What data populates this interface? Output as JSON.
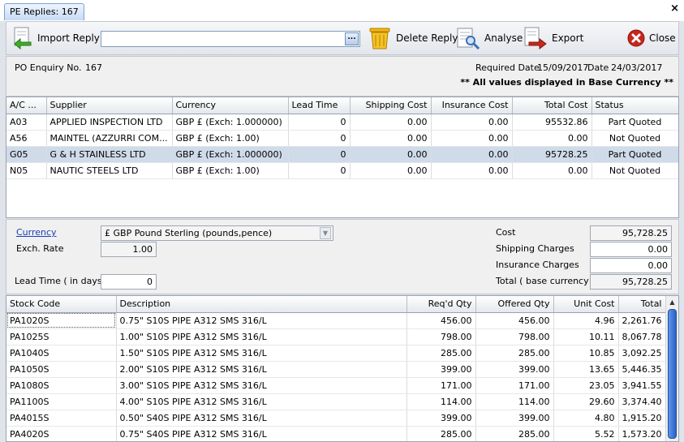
{
  "window": {
    "tab_title": "PE Replies: 167",
    "close_glyph": "×"
  },
  "toolbar": {
    "import_label": "Import Reply",
    "import_value": "",
    "browse_label": "...",
    "delete_label": "Delete Reply",
    "analyse_label": "Analyse",
    "export_label": "Export",
    "close_label": "Close"
  },
  "header": {
    "po_label": "PO Enquiry No.",
    "po_value": "167",
    "required_date_label": "Required Date",
    "required_date_value": "15/09/2017",
    "date_label": "Date",
    "date_value": "24/03/2017",
    "base_currency_note": "** All values displayed in Base Currency **"
  },
  "suppliers": {
    "columns": [
      "A/C ...",
      "Supplier",
      "Currency",
      "Lead Time",
      "Shipping Cost",
      "Insurance Cost",
      "Total Cost",
      "Status"
    ],
    "rows": [
      [
        "A03",
        "APPLIED INSPECTION LTD",
        "GBP £ (Exch: 1.000000)",
        "0",
        "0.00",
        "0.00",
        "95532.86",
        "Part Quoted"
      ],
      [
        "A56",
        "MAINTEL (AZZURRI COM...",
        "GBP £ (Exch: 1.00)",
        "0",
        "0.00",
        "0.00",
        "0.00",
        "Not Quoted"
      ],
      [
        "G05",
        "G & H STAINLESS LTD",
        "GBP £ (Exch: 1.000000)",
        "0",
        "0.00",
        "0.00",
        "95728.25",
        "Part Quoted"
      ],
      [
        "N05",
        "NAUTIC STEELS LTD",
        "GBP £ (Exch: 1.00)",
        "0",
        "0.00",
        "0.00",
        "0.00",
        "Not Quoted"
      ]
    ],
    "selected_row": 2
  },
  "detail": {
    "currency_label": "Currency",
    "currency_value": "£ GBP Pound Sterling (pounds,pence)",
    "exch_rate_label": "Exch. Rate",
    "exch_rate_value": "1.00",
    "lead_time_label": "Lead Time ( in days )",
    "lead_time_value": "0",
    "cost_label": "Cost",
    "cost_value": "95,728.25",
    "shipping_label": "Shipping Charges",
    "shipping_value": "0.00",
    "insurance_label": "Insurance Charges",
    "insurance_value": "0.00",
    "total_label": "Total ( base currency )",
    "total_value": "95,728.25"
  },
  "items": {
    "columns": [
      "Stock Code",
      "Description",
      "Req'd Qty",
      "Offered Qty",
      "Unit Cost",
      "Total"
    ],
    "rows": [
      [
        "PA1020S",
        "0.75\" S10S PIPE A312 SMS 316/L",
        "456.00",
        "456.00",
        "4.96",
        "2,261.76"
      ],
      [
        "PA1025S",
        "1.00\" S10S PIPE A312 SMS 316/L",
        "798.00",
        "798.00",
        "10.11",
        "8,067.78"
      ],
      [
        "PA1040S",
        "1.50\" S10S PIPE A312 SMS 316/L",
        "285.00",
        "285.00",
        "10.85",
        "3,092.25"
      ],
      [
        "PA1050S",
        "2.00\" S10S PIPE A312 SMS 316/L",
        "399.00",
        "399.00",
        "13.65",
        "5,446.35"
      ],
      [
        "PA1080S",
        "3.00\" S10S PIPE A312 SMS 316/L",
        "171.00",
        "171.00",
        "23.05",
        "3,941.55"
      ],
      [
        "PA1100S",
        "4.00\" S10S PIPE A312 SMS 316/L",
        "114.00",
        "114.00",
        "29.60",
        "3,374.40"
      ],
      [
        "PA4015S",
        "0.50\" S40S PIPE A312 SMS 316/L",
        "399.00",
        "399.00",
        "4.80",
        "1,915.20"
      ],
      [
        "PA4020S",
        "0.75\" S40S PIPE A312 SMS 316/L",
        "285.00",
        "285.00",
        "5.52",
        "1,573.20"
      ]
    ]
  },
  "colors": {
    "accent": "#2a62c7",
    "selected_row": "#d0dbe9",
    "link": "#1a3fb0"
  }
}
